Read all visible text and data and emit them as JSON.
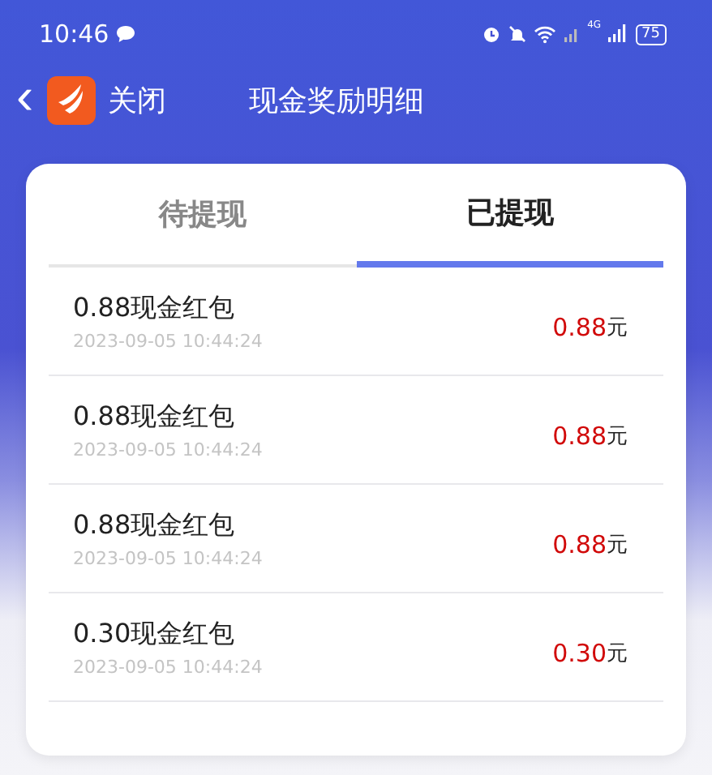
{
  "status_bar": {
    "time": "10:46",
    "network": "4G",
    "battery": "75"
  },
  "header": {
    "back_icon": "‹",
    "close_label": "关闭",
    "title": "现金奖励明细"
  },
  "tabs": [
    {
      "label": "待提现",
      "selected": false
    },
    {
      "label": "已提现",
      "selected": true
    }
  ],
  "records": [
    {
      "title": "0.88现金红包",
      "time": "2023-09-05 10:44:24",
      "amount": "0.88",
      "unit": "元"
    },
    {
      "title": "0.88现金红包",
      "time": "2023-09-05 10:44:24",
      "amount": "0.88",
      "unit": "元"
    },
    {
      "title": "0.88现金红包",
      "time": "2023-09-05 10:44:24",
      "amount": "0.88",
      "unit": "元"
    },
    {
      "title": "0.30现金红包",
      "time": "2023-09-05 10:44:24",
      "amount": "0.30",
      "unit": "元"
    }
  ]
}
